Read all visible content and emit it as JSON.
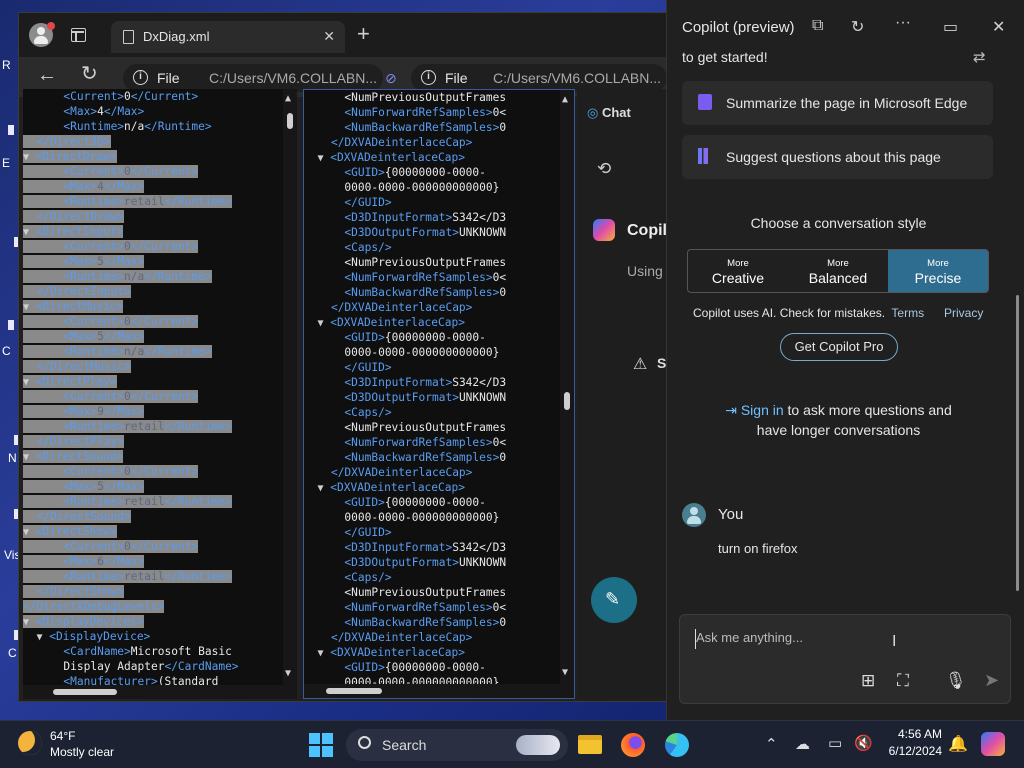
{
  "desktop": {
    "icon_labels": [
      "R",
      "E",
      "C",
      "N",
      "Vis",
      "C"
    ]
  },
  "browser": {
    "tab": {
      "title": "DxDiag.xml"
    },
    "left_address": {
      "scheme": "File",
      "path": "C:/Users/VM6.COLLABN..."
    },
    "right_address": {
      "scheme": "File",
      "path": "C:/Users/VM6.COLLABN..."
    },
    "pane1_lines": [
      {
        "t": "      <Current>0</Current>"
      },
      {
        "t": "      <Max>4</Max>"
      },
      {
        "t": "      <Runtime>n/a</Runtime>"
      },
      {
        "t": "  </Direct3D>",
        "s": true
      },
      {
        "t": "▼ <DirectDraw>",
        "s": true
      },
      {
        "t": "      <Current>0</Current>",
        "s": true
      },
      {
        "t": "      <Max>4</Max>",
        "s": true
      },
      {
        "t": "      <Runtime>retail</Runtime>",
        "s": true
      },
      {
        "t": "  </DirectDraw>",
        "s": true
      },
      {
        "t": "▼ <DirectInput>",
        "s": true
      },
      {
        "t": "      <Current>0</Current>",
        "s": true
      },
      {
        "t": "      <Max>5</Max>",
        "s": true
      },
      {
        "t": "      <Runtime>n/a</Runtime>",
        "s": true
      },
      {
        "t": "  </DirectInput>",
        "s": true
      },
      {
        "t": "▼ <DirectMusic>",
        "s": true
      },
      {
        "t": "      <Current>0</Current>",
        "s": true
      },
      {
        "t": "      <Max>5</Max>",
        "s": true
      },
      {
        "t": "      <Runtime>n/a</Runtime>",
        "s": true
      },
      {
        "t": "  </DirectMusic>",
        "s": true
      },
      {
        "t": "▼ <DirectPlay>",
        "s": true
      },
      {
        "t": "      <Current>0</Current>",
        "s": true
      },
      {
        "t": "      <Max>9</Max>",
        "s": true
      },
      {
        "t": "      <Runtime>retail</Runtime>",
        "s": true
      },
      {
        "t": "  </DirectPlay>",
        "s": true
      },
      {
        "t": "▼ <DirectSound>",
        "s": true
      },
      {
        "t": "      <Current>0</Current>",
        "s": true
      },
      {
        "t": "      <Max>5</Max>",
        "s": true
      },
      {
        "t": "      <Runtime>retail</Runtime>",
        "s": true
      },
      {
        "t": "  </DirectSound>",
        "s": true
      },
      {
        "t": "▼ <DirectShow>",
        "s": true
      },
      {
        "t": "      <Current>0</Current>",
        "s": true
      },
      {
        "t": "      <Max>6</Max>",
        "s": true
      },
      {
        "t": "      <Runtime>retail</Runtime>",
        "s": true
      },
      {
        "t": "  </DirectShow>",
        "s": true
      },
      {
        "t": "</DirectXDebugLevels>",
        "s": true
      },
      {
        "t": "▼ <DisplayDevices>",
        "s": true
      },
      {
        "t": "  ▼ <DisplayDevice>"
      },
      {
        "t": "      <CardName>Microsoft Basic"
      },
      {
        "t": "      Display Adapter</CardName>"
      },
      {
        "t": "      <Manufacturer>(Standard"
      }
    ],
    "pane2_lines": [
      {
        "t": "      <NumPreviousOutputFrames"
      },
      {
        "t": "      <NumForwardRefSamples>0<"
      },
      {
        "t": "      <NumBackwardRefSamples>0"
      },
      {
        "t": "    </DXVADeinterlaceCap>"
      },
      {
        "t": "  ▼ <DXVADeinterlaceCap>"
      },
      {
        "t": "      <GUID>{00000000-0000-"
      },
      {
        "t": "      0000-0000-000000000000}"
      },
      {
        "t": "      </GUID>"
      },
      {
        "t": "      <D3DInputFormat>S342</D3"
      },
      {
        "t": "      <D3DOutputFormat>UNKNOWN"
      },
      {
        "t": "      <Caps/>"
      },
      {
        "t": "      <NumPreviousOutputFrames"
      },
      {
        "t": "      <NumForwardRefSamples>0<"
      },
      {
        "t": "      <NumBackwardRefSamples>0"
      },
      {
        "t": "    </DXVADeinterlaceCap>"
      },
      {
        "t": "  ▼ <DXVADeinterlaceCap>"
      },
      {
        "t": "      <GUID>{00000000-0000-"
      },
      {
        "t": "      0000-0000-000000000000}"
      },
      {
        "t": "      </GUID>"
      },
      {
        "t": "      <D3DInputFormat>S342</D3"
      },
      {
        "t": "      <D3DOutputFormat>UNKNOWN"
      },
      {
        "t": "      <Caps/>"
      },
      {
        "t": "      <NumPreviousOutputFrames"
      },
      {
        "t": "      <NumForwardRefSamples>0<"
      },
      {
        "t": "      <NumBackwardRefSamples>0"
      },
      {
        "t": "    </DXVADeinterlaceCap>"
      },
      {
        "t": "  ▼ <DXVADeinterlaceCap>"
      },
      {
        "t": "      <GUID>{00000000-0000-"
      },
      {
        "t": "      0000-0000-000000000000}"
      },
      {
        "t": "      </GUID>"
      },
      {
        "t": "      <D3DInputFormat>S342</D3"
      },
      {
        "t": "      <D3DOutputFormat>UNKNOWN"
      },
      {
        "t": "      <Caps/>"
      },
      {
        "t": "      <NumPreviousOutputFrames"
      },
      {
        "t": "      <NumForwardRefSamples>0<"
      },
      {
        "t": "      <NumBackwardRefSamples>0"
      },
      {
        "t": "    </DXVADeinterlaceCap>"
      },
      {
        "t": "  ▼ <DXVADeinterlaceCap>"
      },
      {
        "t": "      <GUID>{00000000-0000-"
      },
      {
        "t": "      0000-0000-000000000000}"
      }
    ],
    "pane3": {
      "tab_chat": "Chat",
      "copilot_partial": "Copilo",
      "using_partial": "Using",
      "warn_partial": "S"
    }
  },
  "copilot": {
    "header_title": "Copilot (preview)",
    "intro_text": "to get started!",
    "suggestion_1": "Summarize the page in Microsoft Edge",
    "suggestion_2": "Suggest questions about this page",
    "style_heading": "Choose a conversation style",
    "styles": [
      {
        "small": "More",
        "big": "Creative"
      },
      {
        "small": "More",
        "big": "Balanced"
      },
      {
        "small": "More",
        "big": "Precise"
      }
    ],
    "disclaimer": "Copilot uses AI. Check for mistakes.",
    "terms": "Terms",
    "privacy": "Privacy",
    "pro_button": "Get Copilot Pro",
    "signin_link": "Sign in",
    "signin_rest": " to ask more questions and",
    "signin_line2": "have longer conversations",
    "user_name": "You",
    "user_message": "turn on firefox",
    "input_placeholder": "Ask me anything..."
  },
  "taskbar": {
    "weather_temp": "64°F",
    "weather_desc": "Mostly clear",
    "search_label": "Search",
    "time": "4:56 AM",
    "date": "6/12/2024"
  },
  "colors": {
    "xml_tag": "#5a9cf0",
    "selection": "#8a8a8a",
    "precise_active": "#2f6d90",
    "accent_link": "#6fc0ff"
  }
}
